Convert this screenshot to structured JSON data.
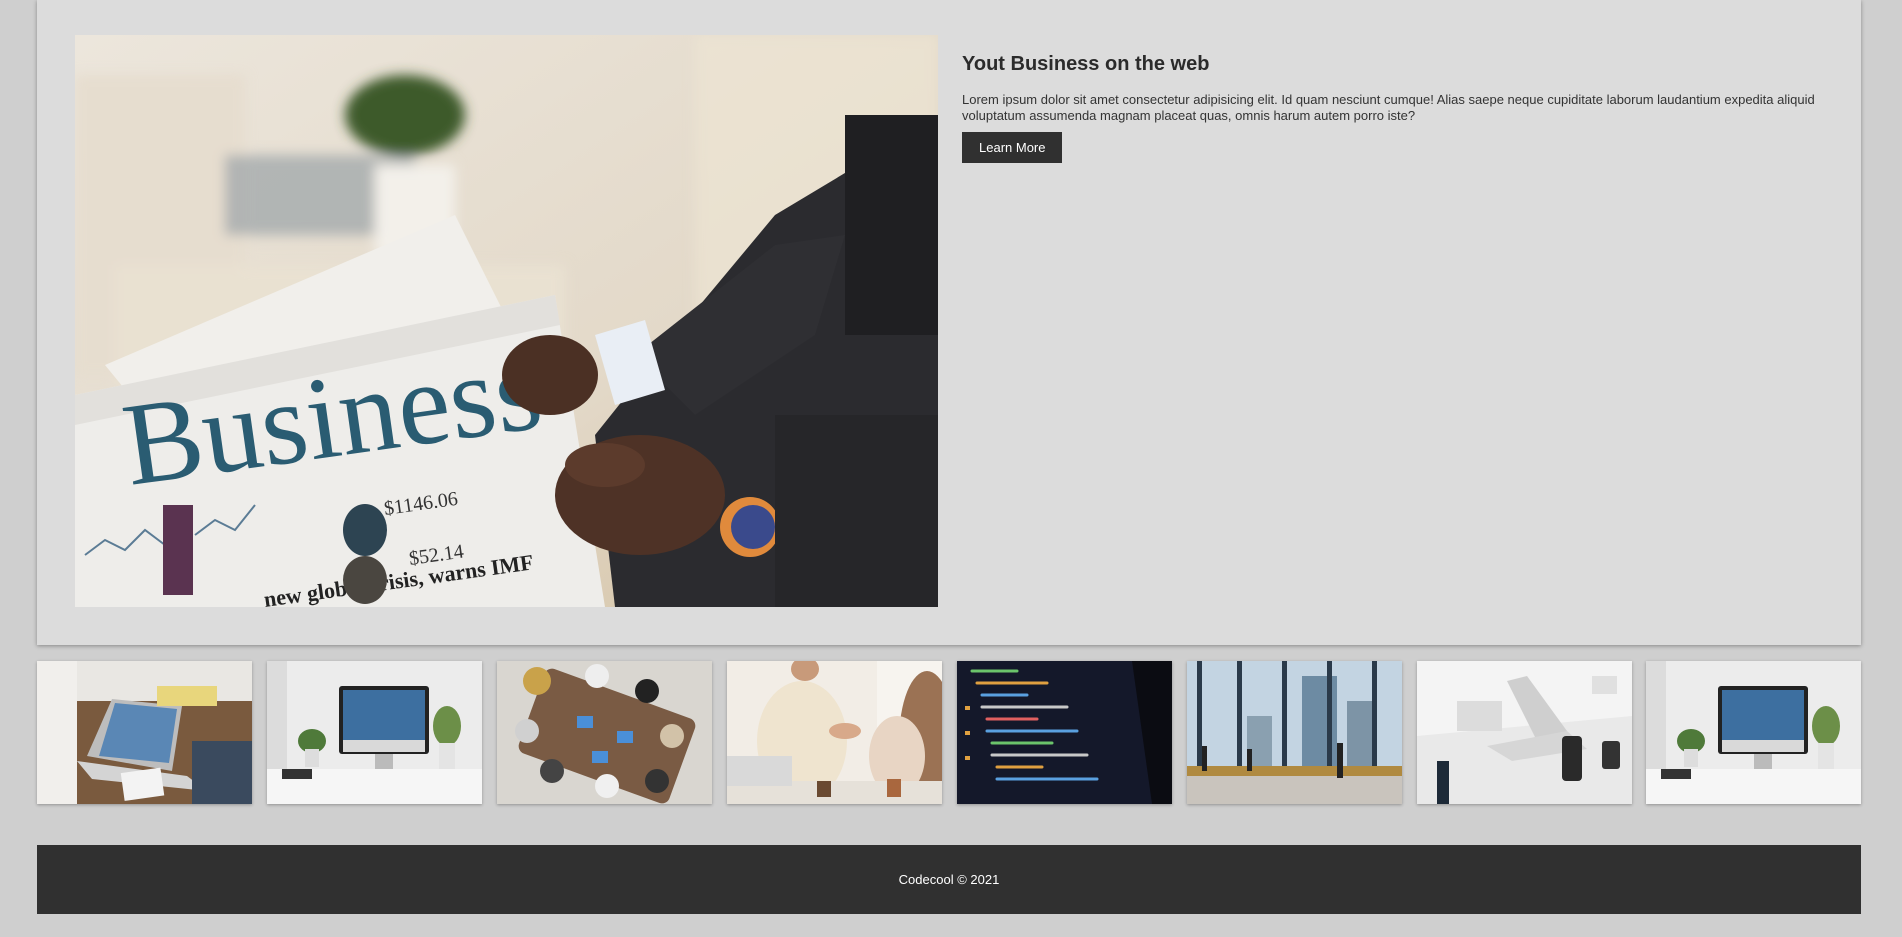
{
  "hero": {
    "title": "Yout Business on the web",
    "description": "Lorem ipsum dolor sit amet consectetur adipisicing elit. Id quam nesciunt cumque! Alias saepe neque cupiditate laborum laudantium expedita aliquid voluptatum assumenda magnam placeat quas, omnis harum autem porro iste?",
    "button_label": "Learn More",
    "image": {
      "newspaper_title": "Business",
      "price1": "$1146.06",
      "price2": "$52.14",
      "headline": "new global crisis, warns IMF"
    }
  },
  "thumbnails": [
    "laptop-desk-photo",
    "imac-desk-photo",
    "team-meeting-photo",
    "handshake-photo",
    "code-screen-photo",
    "city-window-photo",
    "laptop-table-photo",
    "imac-desk-photo-2"
  ],
  "footer": {
    "text": "Codecool © 2021"
  }
}
